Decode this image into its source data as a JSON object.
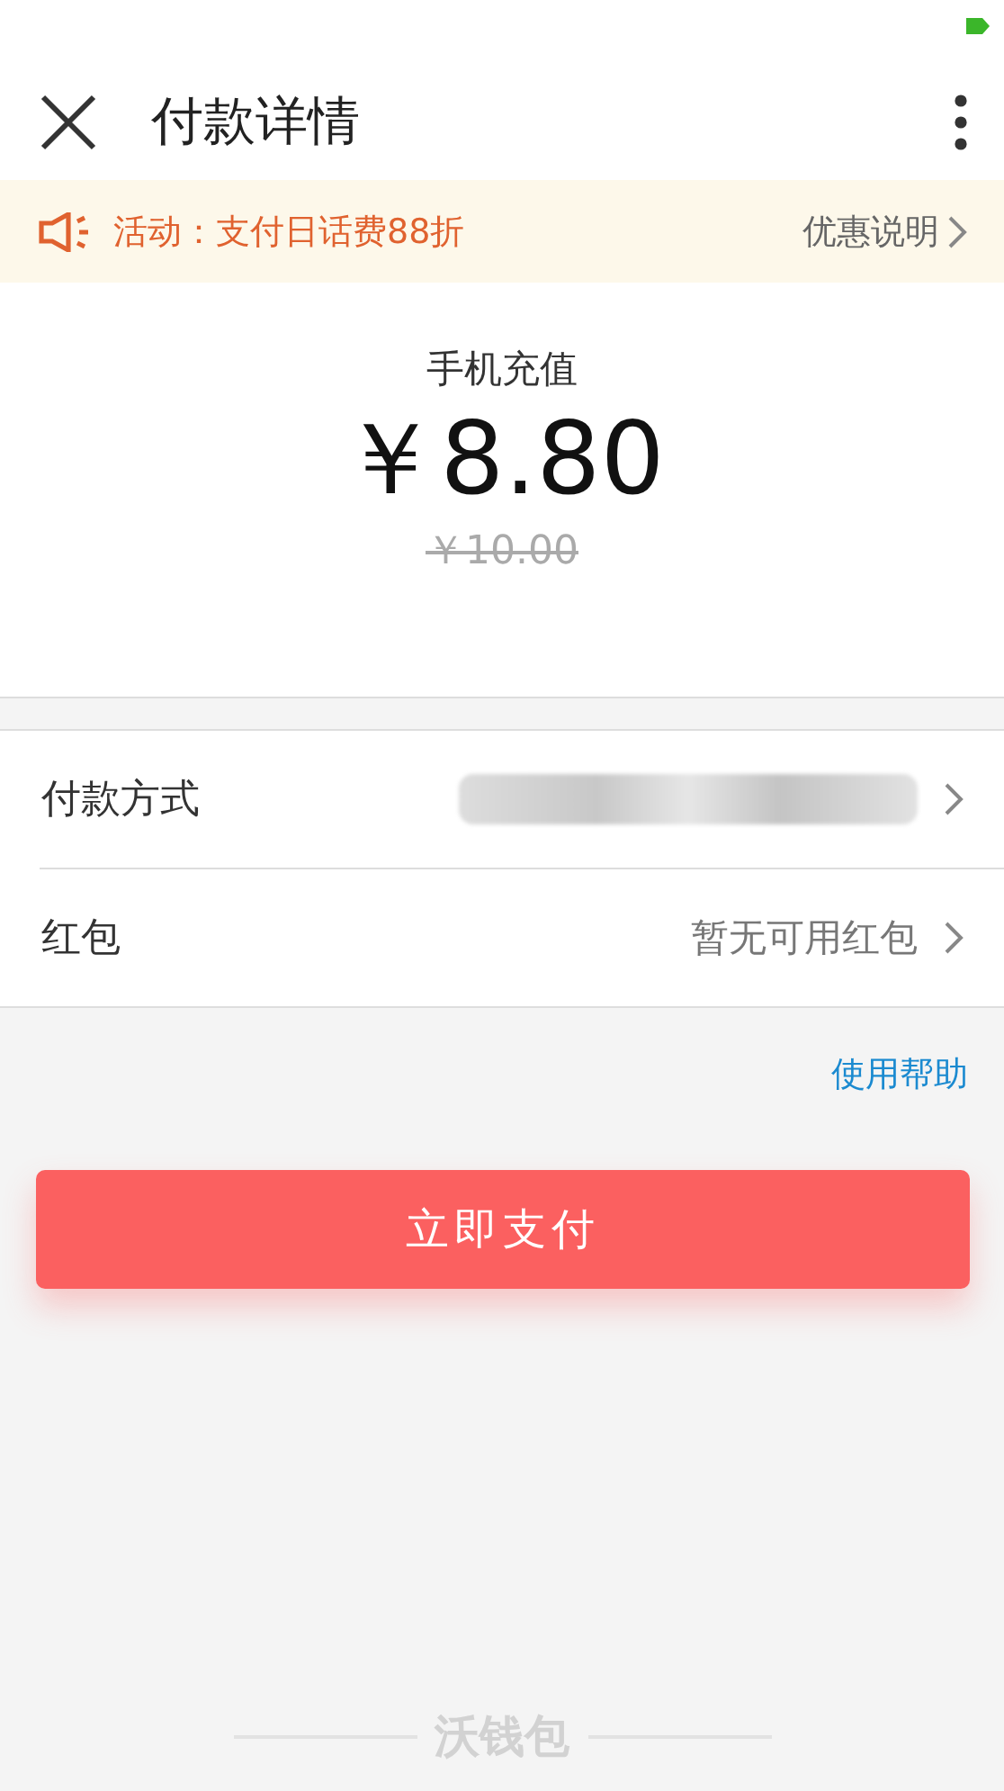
{
  "header": {
    "title": "付款详情"
  },
  "promo": {
    "text": "活动：支付日话费88折",
    "link": "优惠说明"
  },
  "order": {
    "product": "手机充值",
    "price": "￥8.80",
    "original_price": "￥10.00"
  },
  "rows": [
    {
      "label": "付款方式",
      "kind": "blurred"
    },
    {
      "label": "红包",
      "kind": "text",
      "value": "暂无可用红包"
    }
  ],
  "help_link": "使用帮助",
  "pay_button": "立即支付",
  "footer": {
    "brand": "沃钱包"
  }
}
